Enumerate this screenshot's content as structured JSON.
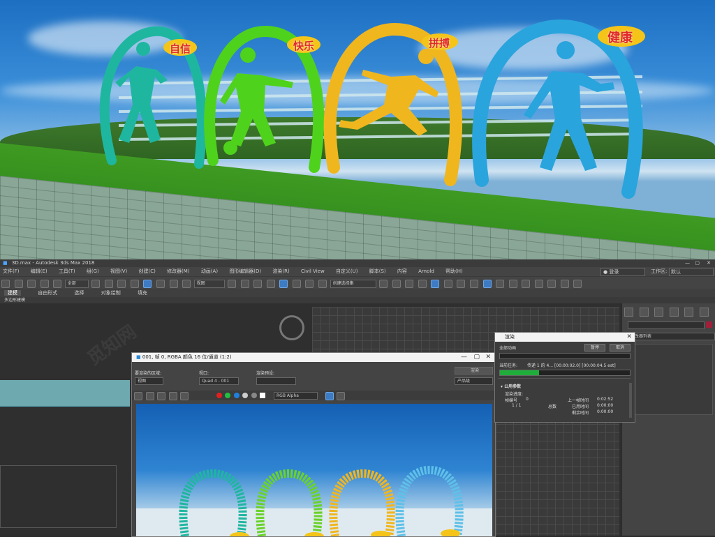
{
  "hero": {
    "signs": [
      "自信",
      "快乐",
      "拼搏",
      "健康"
    ],
    "arch_colors": [
      "#1fb6a0",
      "#4fd21c",
      "#f0b61e",
      "#2aa4dc"
    ],
    "sign_text_color": "#e02828"
  },
  "app": {
    "window_title": "3D.max - Autodesk 3ds Max 2018",
    "window_controls": [
      "—",
      "▢",
      "✕"
    ],
    "menu": [
      "文件(F)",
      "编辑(E)",
      "工具(T)",
      "组(G)",
      "视图(V)",
      "创建(C)",
      "修改器(M)",
      "动画(A)",
      "图形编辑器(D)",
      "渲染(R)",
      "Civil View",
      "自定义(U)",
      "脚本(S)",
      "内容",
      "Arnold",
      "帮助(H)"
    ],
    "login_label": "登录",
    "workspace_label": "工作区:",
    "workspace_value": "默认",
    "toolbar": {
      "filter_select": "全部",
      "view_select": "视图",
      "selection_set": "创建选择集"
    },
    "ribbon_tabs": [
      "建模",
      "自由形式",
      "选择",
      "对象绘制",
      "填充"
    ],
    "ribbon_sub": "多边形建模",
    "cmd_panel": {
      "list_label": "修改器列表"
    }
  },
  "frame_window": {
    "title": "001, 帧 0, RGBA 颜色 16 位/通道 (1:2)",
    "area_label": "要渲染的区域:",
    "area_value": "视图",
    "viewport_label": "视口:",
    "viewport_value": "Quad 4 - 001",
    "preset_label": "渲染预设:",
    "preset_value": "",
    "render_button": "渲染",
    "product_value": "产品级",
    "channel_value": "RGB Alpha"
  },
  "render_dialog": {
    "title": "渲染",
    "overall_label": "全部动画",
    "pause_button": "暂停",
    "cancel_button": "取消",
    "current_task_label": "当前任务:",
    "current_task_value": "传递 1 的 4... [00:00:02.0] [00:00:04.5 est]",
    "overall_progress": 0.0,
    "task_progress": 0.3,
    "section_label": "公用参数",
    "render_progress_label": "渲染进度:",
    "frame_label": "帧编号",
    "frame_value": "0",
    "frame_count": "1 / 1",
    "total_label": "总数",
    "last_frame_label": "上一帧时间",
    "last_frame_value": "0:02:52",
    "elapsed_label": "已用时间",
    "elapsed_value": "0:00:00",
    "remaining_label": "剩余时间",
    "remaining_value": "0:00:00"
  }
}
